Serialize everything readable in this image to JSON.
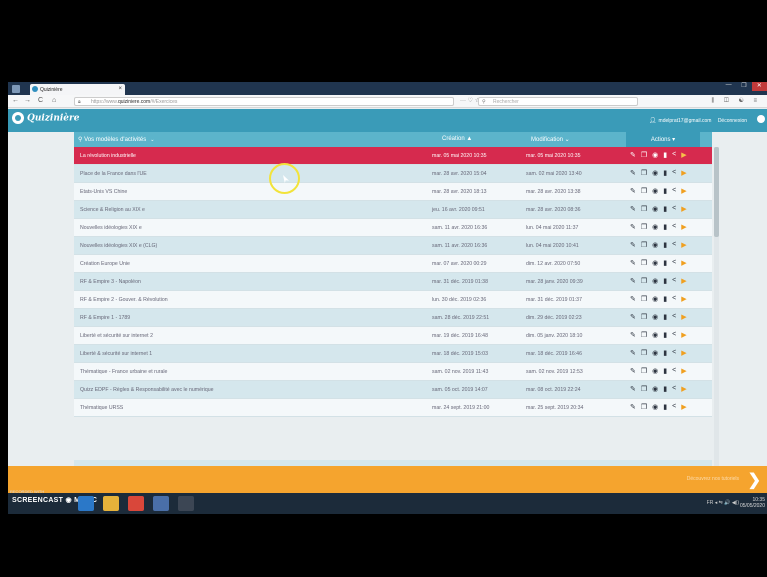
{
  "browser": {
    "tab_title": "Quizinière",
    "tab_close": "×",
    "url_prefix": "https://www.",
    "url_main": "quiziniere.com",
    "url_rest": "/#/Exercices",
    "page_action_icons": "··· ♡ ☆",
    "search_placeholder": "Rechercher",
    "window_buttons": [
      "—",
      "❐",
      "✕"
    ],
    "nav_icons": [
      "←",
      "→",
      "C",
      "⌂"
    ],
    "toolbar_icons": "⫼ ◫ ☯ ≡"
  },
  "app": {
    "logo_text": "Quizinière",
    "user_email": "mdelprat17@gmail.com",
    "logout_label": "Déconnexion"
  },
  "table": {
    "header_title": "Vos modèles d'activités",
    "header_created": "Création ▲",
    "header_modified": "Modification ⌄",
    "header_actions": "Actions ▾",
    "rows": [
      {
        "title": "La révolution industrielle",
        "created": "mar. 05 mai 2020 10:35",
        "modified": "mar. 05 mai 2020 10:35"
      },
      {
        "title": "Place de la France dans l'UE",
        "created": "mar. 28 avr. 2020 15:04",
        "modified": "sam. 02 mai 2020 13:40"
      },
      {
        "title": "Etats-Unis VS Chine",
        "created": "mar. 28 avr. 2020 18:13",
        "modified": "mar. 28 avr. 2020 13:38"
      },
      {
        "title": "Science & Religion au XIX e",
        "created": "jeu. 16 avr. 2020 09:51",
        "modified": "mar. 28 avr. 2020 08:36"
      },
      {
        "title": "Nouvelles idéologies XIX e",
        "created": "sam. 11 avr. 2020 16:36",
        "modified": "lun. 04 mai 2020 11:37"
      },
      {
        "title": "Nouvelles idéologies XIX e (CLG)",
        "created": "sam. 11 avr. 2020 16:36",
        "modified": "lun. 04 mai 2020 10:41"
      },
      {
        "title": "Création Europe Unie",
        "created": "mar. 07 avr. 2020 00:29",
        "modified": "dim. 12 avr. 2020 07:50"
      },
      {
        "title": "RF & Empire 3 - Napoléon",
        "created": "mar. 31 déc. 2019 01:38",
        "modified": "mar. 28 janv. 2020 09:39"
      },
      {
        "title": "RF & Empire 2 - Gouver. & Révolution",
        "created": "lun. 30 déc. 2019 02:36",
        "modified": "mar. 31 déc. 2019 01:37"
      },
      {
        "title": "RF & Empire 1 - 1789",
        "created": "sam. 28 déc. 2019 22:51",
        "modified": "dim. 29 déc. 2019 02:23"
      },
      {
        "title": "Liberté et sécurité sur internet 2",
        "created": "mar. 19 déc. 2019 16:48",
        "modified": "dim. 05 janv. 2020 18:10"
      },
      {
        "title": "Liberté & sécurité sur internet 1",
        "created": "mar. 18 déc. 2019 15:03",
        "modified": "mar. 18 déc. 2019 16:46"
      },
      {
        "title": "Thématique - France urbaine et rurale",
        "created": "sam. 02 nov. 2019 11:43",
        "modified": "sam. 02 nov. 2019 12:53"
      },
      {
        "title": "Quizz EDPF - Règles & Responsabilité avec le numérique",
        "created": "sam. 05 oct. 2019 14:07",
        "modified": "mar. 08 oct. 2019 22:24"
      },
      {
        "title": "Thématique URSS",
        "created": "mar. 24 sept. 2019 21:00",
        "modified": "mar. 25 sept. 2019 20:34"
      }
    ]
  },
  "actions_icons": {
    "edit": "✎",
    "copy": "❐",
    "view": "◉",
    "delete": "▮",
    "share": "<",
    "play": "▶"
  },
  "banner": {
    "text": "Découvrez nos tutoriels",
    "arrow": "❯"
  },
  "taskbar": {
    "recorded_with": "RECORDED WITH",
    "brand": "SCREENCAST ◉ MATIC",
    "tray_text": "FR ◂ ⇋ 🔊 ◀))",
    "clock_time": "10:35",
    "clock_date": "05/05/2020"
  },
  "colors": {
    "header_teal": "#3a9bb8",
    "table_header_teal": "#5cb4cb",
    "active_row": "#d62a4e",
    "banner_orange": "#f5a42e",
    "play_orange": "#f0a020"
  }
}
